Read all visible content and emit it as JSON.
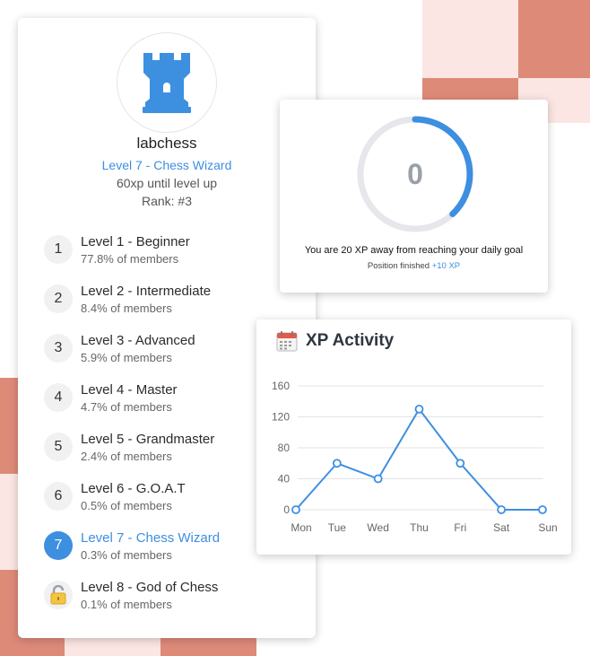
{
  "profile": {
    "username": "labchess",
    "level_title": "Level 7 - Chess Wizard",
    "xp_until_level_up": "60xp until level up",
    "rank": "Rank: #3"
  },
  "levels": [
    {
      "badge": "1",
      "name": "Level 1 - Beginner",
      "share": "77.8% of members"
    },
    {
      "badge": "2",
      "name": "Level 2 - Intermediate",
      "share": "8.4% of members"
    },
    {
      "badge": "3",
      "name": "Level 3 - Advanced",
      "share": "5.9% of members"
    },
    {
      "badge": "4",
      "name": "Level 4 - Master",
      "share": "4.7% of members"
    },
    {
      "badge": "5",
      "name": "Level 5 - Grandmaster",
      "share": "2.4% of members"
    },
    {
      "badge": "6",
      "name": "Level 6 - G.O.A.T",
      "share": "0.5% of members"
    },
    {
      "badge": "7",
      "name": "Level 7 - Chess Wizard",
      "share": "0.3% of members",
      "current": true
    },
    {
      "badge": "lock-icon",
      "name": "Level 8 - God of Chess",
      "share": "0.1% of members",
      "locked": true
    }
  ],
  "goal": {
    "value": "0",
    "message": "You are 20 XP away from reaching your daily goal",
    "position_text": "Position finished",
    "position_xp": "+10 XP",
    "ring_progress": 0.38
  },
  "colors": {
    "accent": "#3d8fe0",
    "checker_dark": "#de8a79",
    "checker_light": "#fbe6e3"
  },
  "chart_data": {
    "type": "line",
    "title": "XP Activity",
    "icon": "calendar-icon",
    "categories": [
      "Mon",
      "Tue",
      "Wed",
      "Thu",
      "Fri",
      "Sat",
      "Sun"
    ],
    "values": [
      0,
      60,
      40,
      130,
      60,
      0,
      0
    ],
    "yticks": [
      0,
      40,
      80,
      120,
      160
    ],
    "ylim": [
      0,
      160
    ],
    "grid": true,
    "color": "#3d8fe0"
  }
}
